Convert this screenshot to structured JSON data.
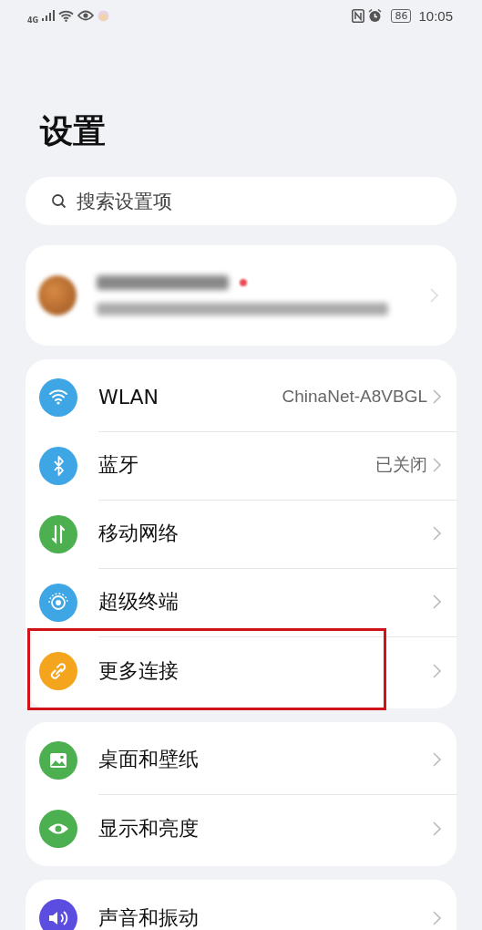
{
  "status_bar": {
    "network": "4G",
    "battery": "86",
    "time": "10:05"
  },
  "title": "设置",
  "search": {
    "placeholder": "搜索设置项"
  },
  "account": {
    "kind": "blurred",
    "notification_dot": true
  },
  "groups": [
    {
      "items": [
        {
          "kind": "wifi",
          "label": "WLAN",
          "value": "ChinaNet-A8VBGL",
          "color": "#3fa6e6",
          "highlighted": false
        },
        {
          "kind": "bluetooth",
          "label": "蓝牙",
          "value": "已关闭",
          "color": "#3fa6e6",
          "highlighted": false
        },
        {
          "kind": "mobile",
          "label": "移动网络",
          "color": "#4caf50",
          "highlighted": false
        },
        {
          "kind": "devices",
          "label": "超级终端",
          "color": "#3fa6e6",
          "highlighted": false
        },
        {
          "kind": "link",
          "label": "更多连接",
          "color": "#f5a41d",
          "highlighted": true
        }
      ]
    },
    {
      "items": [
        {
          "kind": "wallpaper",
          "label": "桌面和壁纸",
          "color": "#4caf50",
          "highlighted": false
        },
        {
          "kind": "display",
          "label": "显示和亮度",
          "color": "#4caf50",
          "highlighted": false
        }
      ]
    },
    {
      "items": [
        {
          "kind": "sound",
          "label": "声音和振动",
          "color": "#5b4de0",
          "highlighted": false
        }
      ]
    }
  ]
}
